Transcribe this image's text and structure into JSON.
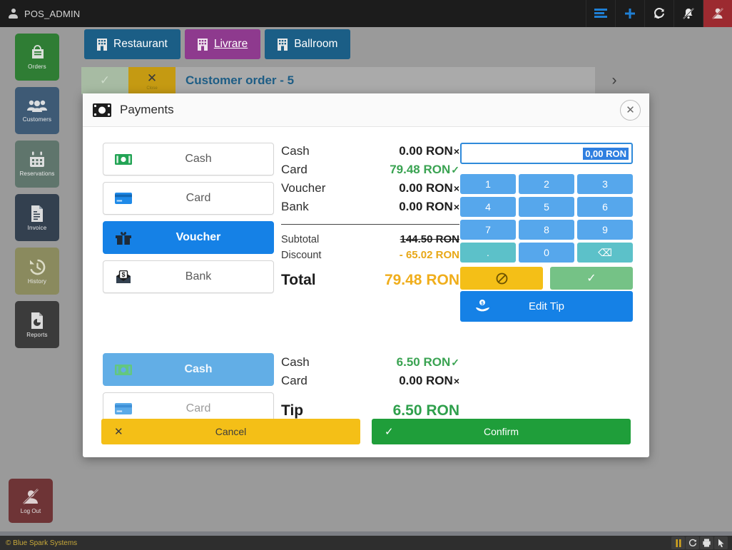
{
  "topbar": {
    "user": "POS_ADMIN",
    "user_icon": "user-icon",
    "actions": [
      {
        "name": "list-view-icon",
        "glyph": "☰"
      },
      {
        "name": "add-icon",
        "glyph": "＋"
      },
      {
        "name": "refresh-icon",
        "glyph": "↻"
      },
      {
        "name": "bell-slash-icon",
        "glyph": "🔔"
      },
      {
        "name": "user-logout-icon",
        "glyph": "👤"
      }
    ]
  },
  "sidebar": {
    "items": [
      {
        "label": "Orders",
        "icon": "orders-icon",
        "color": "#2f7d34"
      },
      {
        "label": "Customers",
        "icon": "customers-icon",
        "color": "#3e5a75"
      },
      {
        "label": "Reservations",
        "icon": "reservations-icon",
        "color": "#5f756c"
      },
      {
        "label": "Invoice",
        "icon": "invoice-icon",
        "color": "#33404f"
      },
      {
        "label": "History",
        "icon": "history-icon",
        "color": "#8a8a5e"
      },
      {
        "label": "Reports",
        "icon": "reports-icon",
        "color": "#3b3b3b"
      }
    ],
    "logout": {
      "label": "Log Out",
      "icon": "logout-icon",
      "color": "#6e3436"
    }
  },
  "venue_tabs": [
    {
      "label": "Restaurant",
      "icon": "building-icon",
      "active": false
    },
    {
      "label": "Livrare",
      "icon": "building-icon",
      "active": true
    },
    {
      "label": "Ballroom",
      "icon": "building-icon",
      "active": false
    }
  ],
  "order_strip": {
    "accept_icon": "check-icon",
    "close_icon": "x-icon",
    "close_sub": "Close",
    "title": "Customer order - 5",
    "next_icon": "chevron-right-icon"
  },
  "modal": {
    "title": "Payments",
    "title_icon": "banknote-icon",
    "close_icon": "close-icon",
    "payment_methods": [
      {
        "label": "Cash",
        "icon": "cash-icon",
        "selected": false
      },
      {
        "label": "Card",
        "icon": "card-icon",
        "selected": false
      },
      {
        "label": "Voucher",
        "icon": "voucher-icon",
        "selected": true
      },
      {
        "label": "Bank",
        "icon": "bank-icon",
        "selected": false
      }
    ],
    "amounts": [
      {
        "name": "Cash",
        "value": "0.00 RON",
        "mark": "×",
        "paid": false
      },
      {
        "name": "Card",
        "value": "79.48 RON",
        "mark": "✓",
        "paid": true
      },
      {
        "name": "Voucher",
        "value": "0.00 RON",
        "mark": "×",
        "paid": false
      },
      {
        "name": "Bank",
        "value": "0.00 RON",
        "mark": "×",
        "paid": false
      }
    ],
    "summary": {
      "subtotal_label": "Subtotal",
      "subtotal_value": "144.50 RON",
      "discount_label": "Discount",
      "discount_value": "- 65.02 RON",
      "total_label": "Total",
      "total_value": "79.48 RON"
    },
    "keypad": {
      "input_value": "0,00 RON",
      "keys": [
        "1",
        "2",
        "3",
        "4",
        "5",
        "6",
        "7",
        "8",
        "9",
        ".",
        "0",
        "⌫"
      ],
      "cancel_icon": "no-entry-icon",
      "confirm_icon": "check-icon"
    },
    "edit_tip": {
      "label": "Edit Tip",
      "icon": "hand-coin-icon"
    },
    "tip_methods": [
      {
        "label": "Cash",
        "icon": "cash-icon",
        "selected": true
      },
      {
        "label": "Card",
        "icon": "card-icon",
        "selected": false
      }
    ],
    "tip_amounts": [
      {
        "name": "Cash",
        "value": "6.50 RON",
        "mark": "✓",
        "paid": true
      },
      {
        "name": "Card",
        "value": "0.00 RON",
        "mark": "×",
        "paid": false
      }
    ],
    "tip_total": {
      "label": "Tip",
      "value": "6.50 RON"
    },
    "footer": {
      "cancel_label": "Cancel",
      "cancel_icon": "x-icon",
      "confirm_label": "Confirm",
      "confirm_icon": "check-icon"
    }
  },
  "footer": {
    "copyright": "© Blue Spark Systems",
    "icons": [
      {
        "name": "pause-icon",
        "glyph": "‖"
      },
      {
        "name": "refresh-icon",
        "glyph": "↻"
      },
      {
        "name": "printer-icon",
        "glyph": "⎙"
      },
      {
        "name": "cursor-icon",
        "glyph": "↖"
      }
    ]
  },
  "colors": {
    "accent_blue": "#1581e6",
    "tab_blue": "#1b5e86",
    "tab_purple": "#8e3a8e",
    "amber": "#f4bf17",
    "green": "#1f9e3a",
    "total_amber": "#f0ae1c",
    "paid_green": "#3aa352",
    "tip_green": "#2fa04c"
  }
}
